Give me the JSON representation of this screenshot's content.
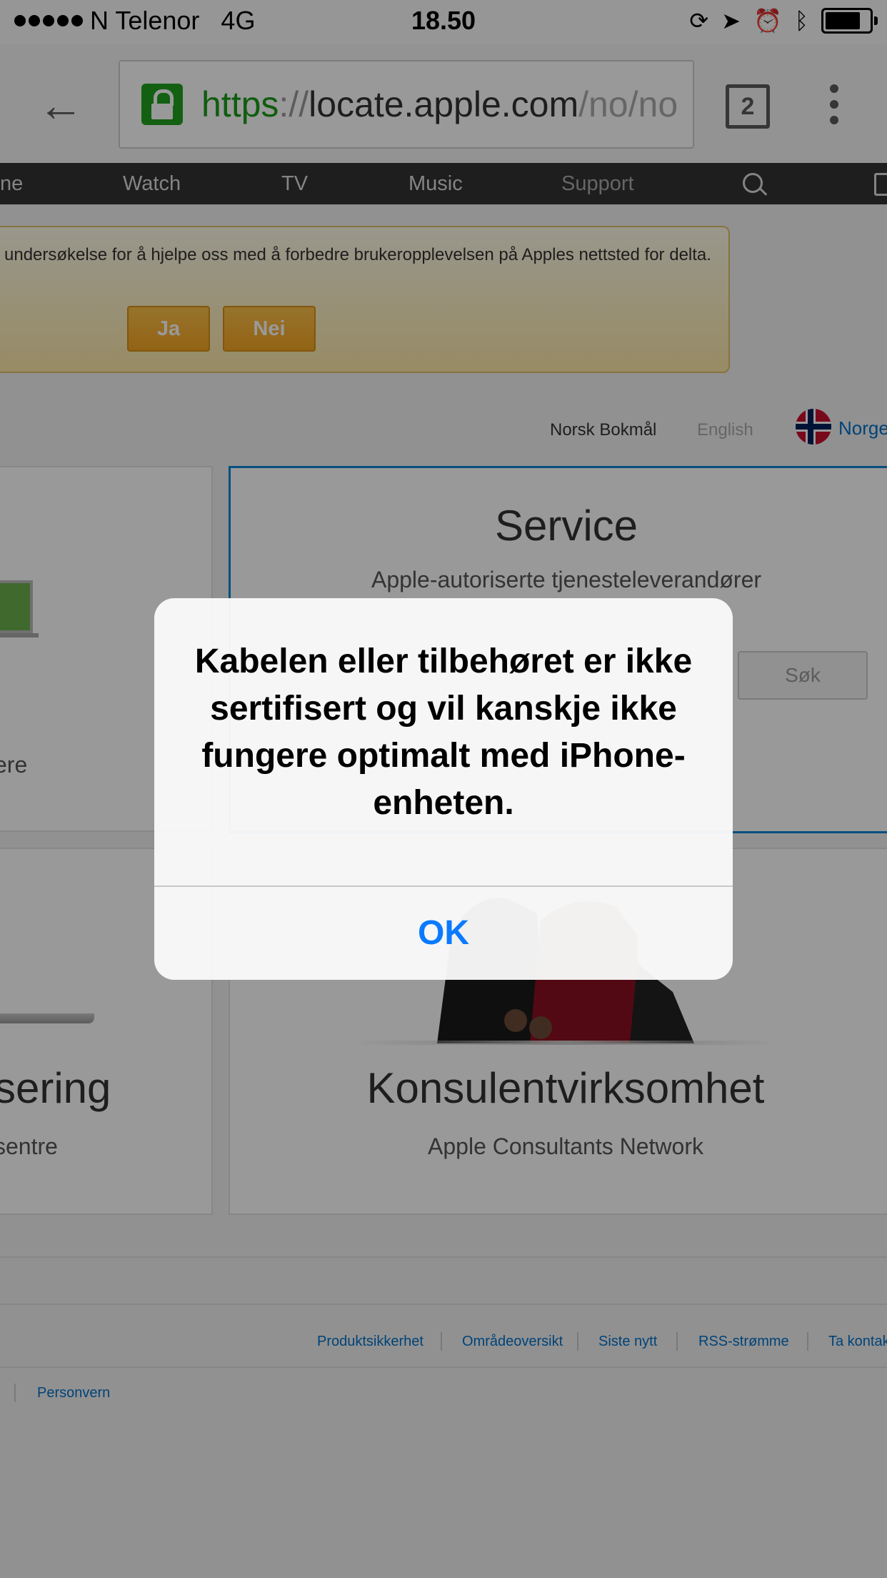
{
  "status_bar": {
    "carrier": "N Telenor",
    "network": "4G",
    "time": "18.50",
    "signal_bars": 5
  },
  "browser": {
    "url_scheme": "https",
    "url_separator": "://",
    "url_host": "locate.apple.com",
    "url_path": "/no/no",
    "tab_count": "2"
  },
  "apple_nav": {
    "items": [
      "ne",
      "Watch",
      "TV",
      "Music",
      "Support"
    ]
  },
  "survey": {
    "text": "undersøkelse for å hjelpe oss med å forbedre brukeropplevelsen på Apples nettsted for delta.",
    "yes_label": "Ja",
    "no_label": "Nei"
  },
  "language": {
    "norsk": "Norsk Bokmål",
    "english": "English",
    "country": "Norge"
  },
  "cards": {
    "left_top_text": "ere",
    "service_title": "Service",
    "service_subtitle": "Apple-autoriserte tjenesteleverandører",
    "service_search": "Søk",
    "left_bottom_title": "sering",
    "left_bottom_sub": "sentre",
    "konsulent_title": "Konsulentvirksomhet",
    "konsulent_subtitle": "Apple Consultants Network"
  },
  "footer": {
    "links": [
      "Produktsikkerhet",
      "Områdeoversikt",
      "Siste nytt",
      "RSS-strømme",
      "Ta kontakt"
    ],
    "privacy": "Personvern"
  },
  "alert": {
    "message": "Kabelen eller tilbehøret er ikke sertifisert og vil kanskje ikke fungere optimalt med iPhone-enheten.",
    "ok_label": "OK"
  },
  "colors": {
    "alert_button": "#0a7aff",
    "secure_green": "#1a9c1a",
    "link_blue": "#0070c9",
    "service_border": "#0a84d8"
  }
}
